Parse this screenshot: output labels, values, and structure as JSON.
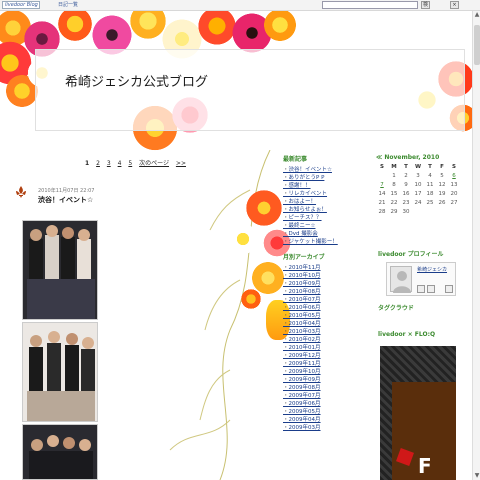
{
  "toolbar": {
    "logo": "livedoor Blog",
    "link": "日記一覧",
    "search_btn": "検",
    "close_btn": "×"
  },
  "header": {
    "title": "希崎ジェシカ公式ブログ"
  },
  "pager": {
    "pages": [
      "1",
      "2",
      "3",
      "4",
      "5"
    ],
    "next": "次のページ",
    "last": ">>"
  },
  "entry": {
    "date": "2010年11月07日 22:07",
    "title": "渋谷！イベント☆"
  },
  "recent": {
    "heading": "最新記事",
    "items": [
      "渋谷！イベント☆",
      "ありがとうP P",
      "感謝！！",
      "リレカイベント",
      "おはよー！",
      "お知らせよぉ！",
      "ピーチス？？",
      "最終ニー☆",
      "Dvd 撮影会",
      "ジャケット撮影ー！"
    ]
  },
  "archive": {
    "heading": "月別アーカイブ",
    "items": [
      "2010年11月",
      "2010年10月",
      "2010年09月",
      "2010年08月",
      "2010年07月",
      "2010年06月",
      "2010年05月",
      "2010年04月",
      "2010年03月",
      "2010年02月",
      "2010年01月",
      "2009年12月",
      "2009年11月",
      "2009年10月",
      "2009年09月",
      "2009年08月",
      "2009年07月",
      "2009年06月",
      "2009年05月",
      "2009年04月",
      "2009年03月"
    ]
  },
  "calendar": {
    "heading": "≪  November, 2010",
    "weekdays": [
      "S",
      "M",
      "T",
      "W",
      "T",
      "F",
      "S"
    ],
    "days": [
      "",
      "1",
      "2",
      "3",
      "4",
      "5",
      "6",
      "7",
      "8",
      "9",
      "10",
      "11",
      "12",
      "13",
      "14",
      "15",
      "16",
      "17",
      "18",
      "19",
      "20",
      "21",
      "22",
      "23",
      "24",
      "25",
      "26",
      "27",
      "28",
      "29",
      "30"
    ],
    "linked_days": [
      "6",
      "7"
    ]
  },
  "profile": {
    "heading": "livedoor プロフィール",
    "name": "希崎ジェシカ"
  },
  "tags": {
    "heading": "タグクラウド"
  },
  "flog": {
    "heading": "livedoor × FLO:Q",
    "letter": "F"
  },
  "colors": {
    "accent_green": "#3b8a2e",
    "link_blue": "#1a3d8a"
  }
}
